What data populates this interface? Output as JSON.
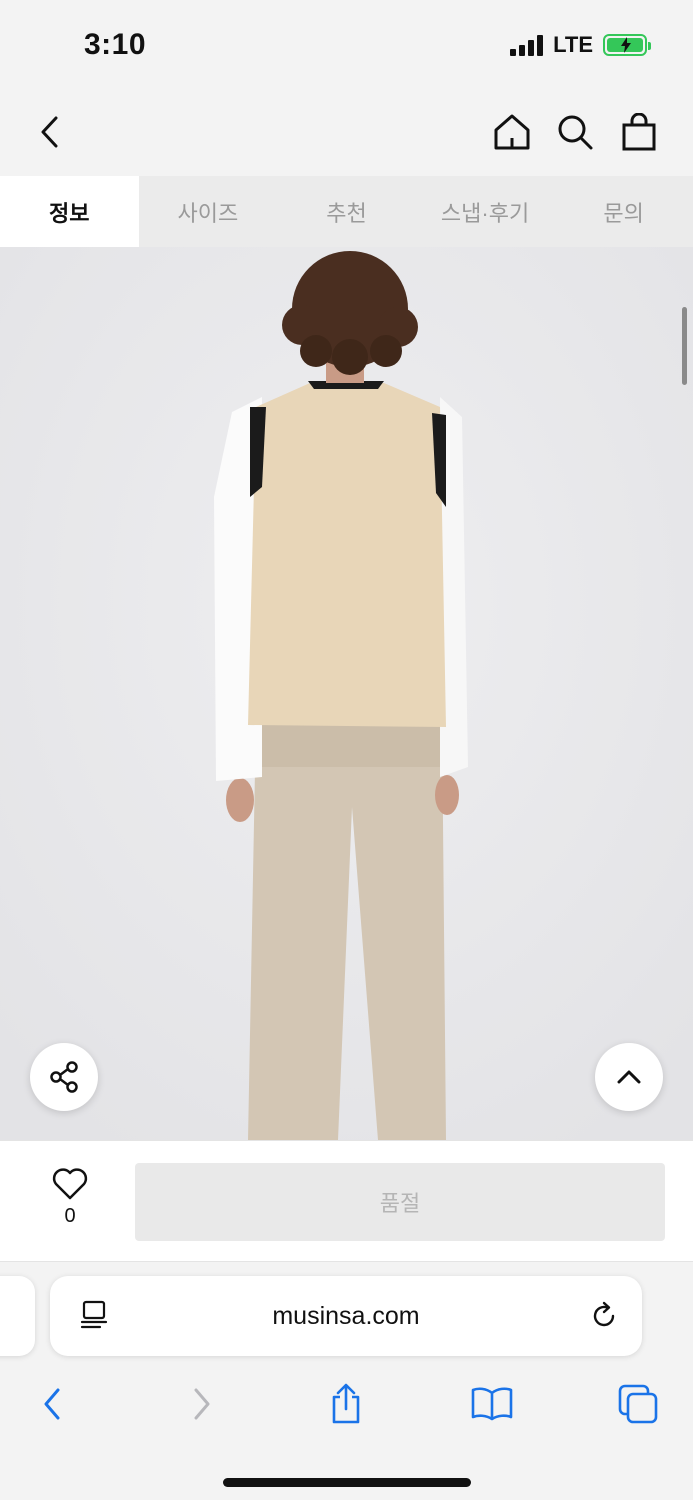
{
  "status_bar": {
    "time": "3:10",
    "network": "LTE",
    "signal_bars": 4,
    "battery_charging": true,
    "battery_color": "#34c759"
  },
  "top_nav": {
    "icons": [
      "back-icon",
      "home-icon",
      "search-icon",
      "bag-icon"
    ]
  },
  "tabs": [
    {
      "label": "정보",
      "active": true
    },
    {
      "label": "사이즈",
      "active": false
    },
    {
      "label": "추천",
      "active": false
    },
    {
      "label": "스냅·후기",
      "active": false
    },
    {
      "label": "문의",
      "active": false
    }
  ],
  "product_image": {
    "icons": [
      "share-icon",
      "scroll-top-icon"
    ]
  },
  "buy_bar": {
    "like_count": "0",
    "soldout_label": "품절"
  },
  "browser": {
    "url": "musinsa.com",
    "accent_color": "#1a73e8",
    "toolbar_icons": [
      "reader-icon",
      "reload-icon",
      "back-icon",
      "forward-icon",
      "share-icon",
      "bookmarks-icon",
      "tabs-icon"
    ]
  }
}
